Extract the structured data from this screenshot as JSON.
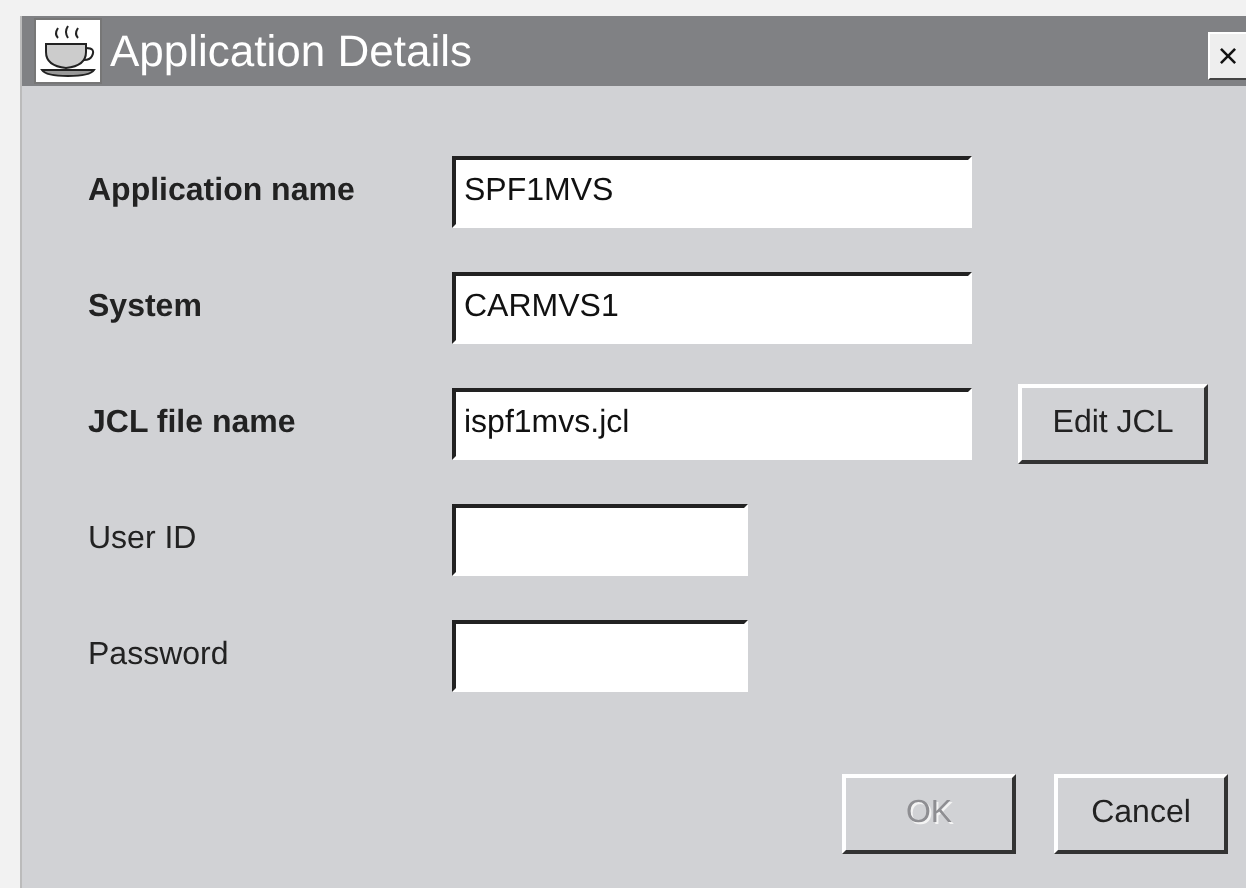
{
  "window": {
    "title": "Application Details",
    "close": "×"
  },
  "fields": [
    {
      "label": "Application name",
      "bold": true,
      "kind": "long",
      "value": "SPF1MVS"
    },
    {
      "label": "System",
      "bold": true,
      "kind": "long",
      "value": "CARMVS1"
    },
    {
      "label": "JCL file name",
      "bold": true,
      "kind": "long",
      "value": "ispf1mvs.jcl",
      "button": "Edit JCL"
    },
    {
      "label": "User ID",
      "bold": false,
      "kind": "short"
    },
    {
      "label": "Password",
      "bold": false,
      "kind": "short"
    }
  ],
  "buttons": [
    {
      "label": "OK",
      "disabled": true
    },
    {
      "label": "Cancel",
      "disabled": false
    }
  ]
}
